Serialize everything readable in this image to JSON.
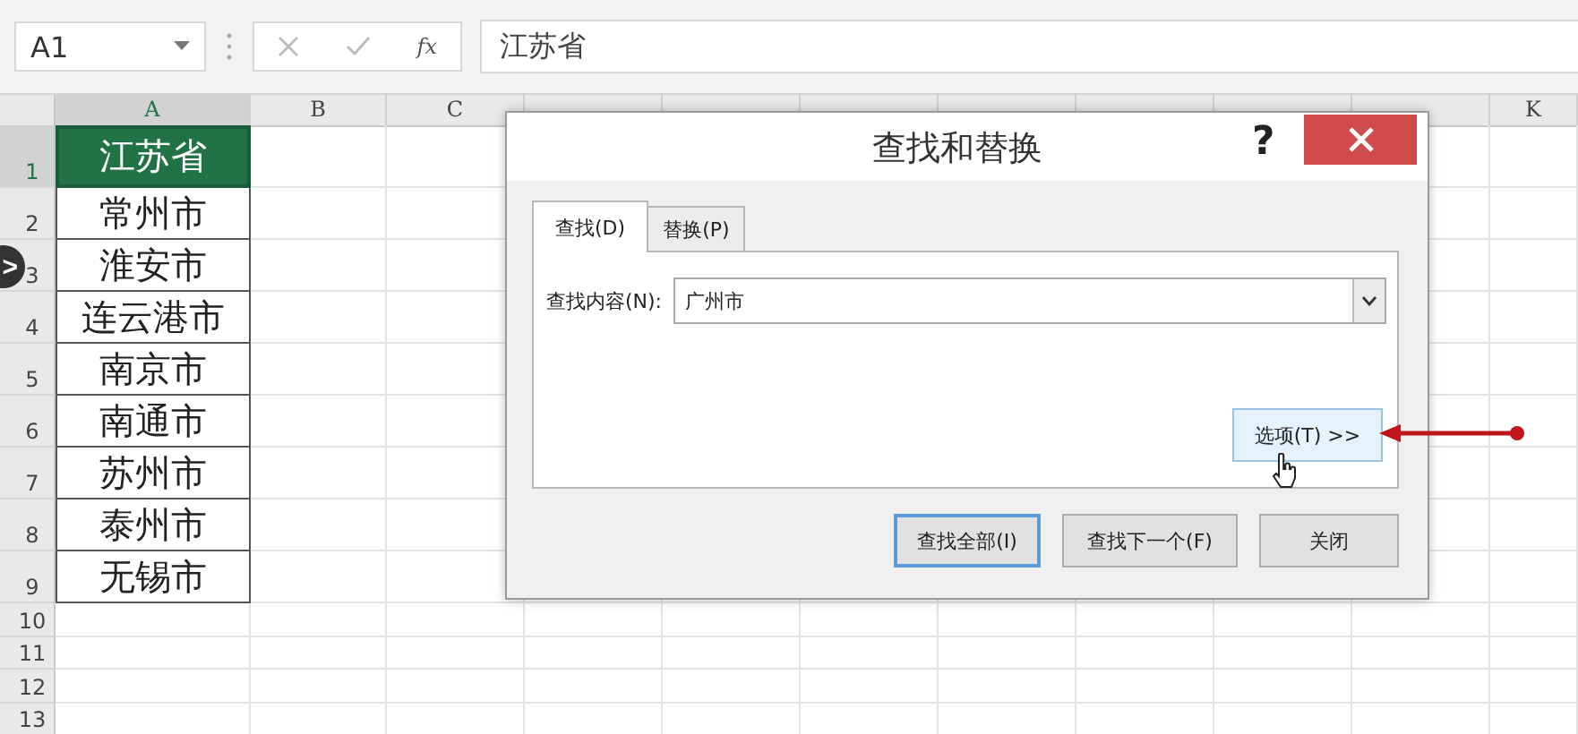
{
  "name_box": {
    "value": "A1"
  },
  "formula_bar": {
    "function_label": "fx",
    "value": "江苏省"
  },
  "columns": [
    {
      "label": "A",
      "selected": true
    },
    {
      "label": "B",
      "selected": false
    },
    {
      "label": "C",
      "selected": false
    },
    {
      "selected": false
    },
    {
      "selected": false
    },
    {
      "selected": false
    },
    {
      "selected": false
    },
    {
      "selected": false
    },
    {
      "selected": false
    },
    {
      "selected": false
    },
    {
      "label": "K",
      "selected": false
    }
  ],
  "rows": [
    {
      "number": "1",
      "selected": true,
      "cell": "江苏省",
      "active": true
    },
    {
      "number": "2",
      "selected": false,
      "cell": "常州市",
      "active": false
    },
    {
      "number": "3",
      "selected": false,
      "cell": "淮安市",
      "active": false
    },
    {
      "number": "4",
      "selected": false,
      "cell": "连云港市",
      "active": false
    },
    {
      "number": "5",
      "selected": false,
      "cell": "南京市",
      "active": false
    },
    {
      "number": "6",
      "selected": false,
      "cell": "南通市",
      "active": false
    },
    {
      "number": "7",
      "selected": false,
      "cell": "苏州市",
      "active": false
    },
    {
      "number": "8",
      "selected": false,
      "cell": "泰州市",
      "active": false
    },
    {
      "number": "9",
      "selected": false,
      "cell": "无锡市",
      "active": false
    },
    {
      "number": "10",
      "selected": false
    },
    {
      "number": "11",
      "selected": false
    },
    {
      "number": "12",
      "selected": false
    },
    {
      "number": "13",
      "selected": false
    }
  ],
  "side_button": {
    "label": ">"
  },
  "dialog": {
    "title": "查找和替换",
    "help": "?",
    "tabs": [
      {
        "label": "查找(D)",
        "selected": true
      },
      {
        "label": "替换(P)",
        "selected": false
      }
    ],
    "find_label": "查找内容(N):",
    "find_value": "广州市",
    "options_button": {
      "label": "选项(T) >>",
      "hovered": true
    },
    "buttons": [
      {
        "label": "查找全部(I)",
        "focused": true
      },
      {
        "label": "查找下一个(F)",
        "focused": false
      },
      {
        "label": "关闭",
        "focused": false
      }
    ]
  },
  "annotation": {
    "kind": "arrow"
  }
}
